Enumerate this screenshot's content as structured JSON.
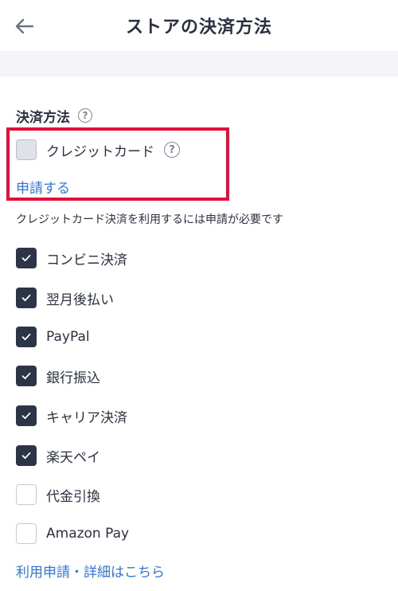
{
  "header": {
    "title": "ストアの決済方法",
    "back_icon": "arrow-left-icon"
  },
  "section": {
    "title": "決済方法",
    "help_icon": "question-circle-icon"
  },
  "credit_card": {
    "label": "クレジットカード",
    "checked": false,
    "disabled": true,
    "apply_link": "申請する",
    "note": "クレジットカード決済を利用するには申請が必要です"
  },
  "methods": [
    {
      "label": "コンビニ決済",
      "checked": true
    },
    {
      "label": "翌月後払い",
      "checked": true
    },
    {
      "label": "PayPal",
      "checked": true
    },
    {
      "label": "銀行振込",
      "checked": true
    },
    {
      "label": "キャリア決済",
      "checked": true
    },
    {
      "label": "楽天ペイ",
      "checked": true
    },
    {
      "label": "代金引換",
      "checked": false
    },
    {
      "label": "Amazon Pay",
      "checked": false
    }
  ],
  "footer_link": "利用申請・詳細はこちら",
  "colors": {
    "checked": "#2c3547",
    "link": "#2f76e0",
    "highlight": "#e4103b"
  }
}
